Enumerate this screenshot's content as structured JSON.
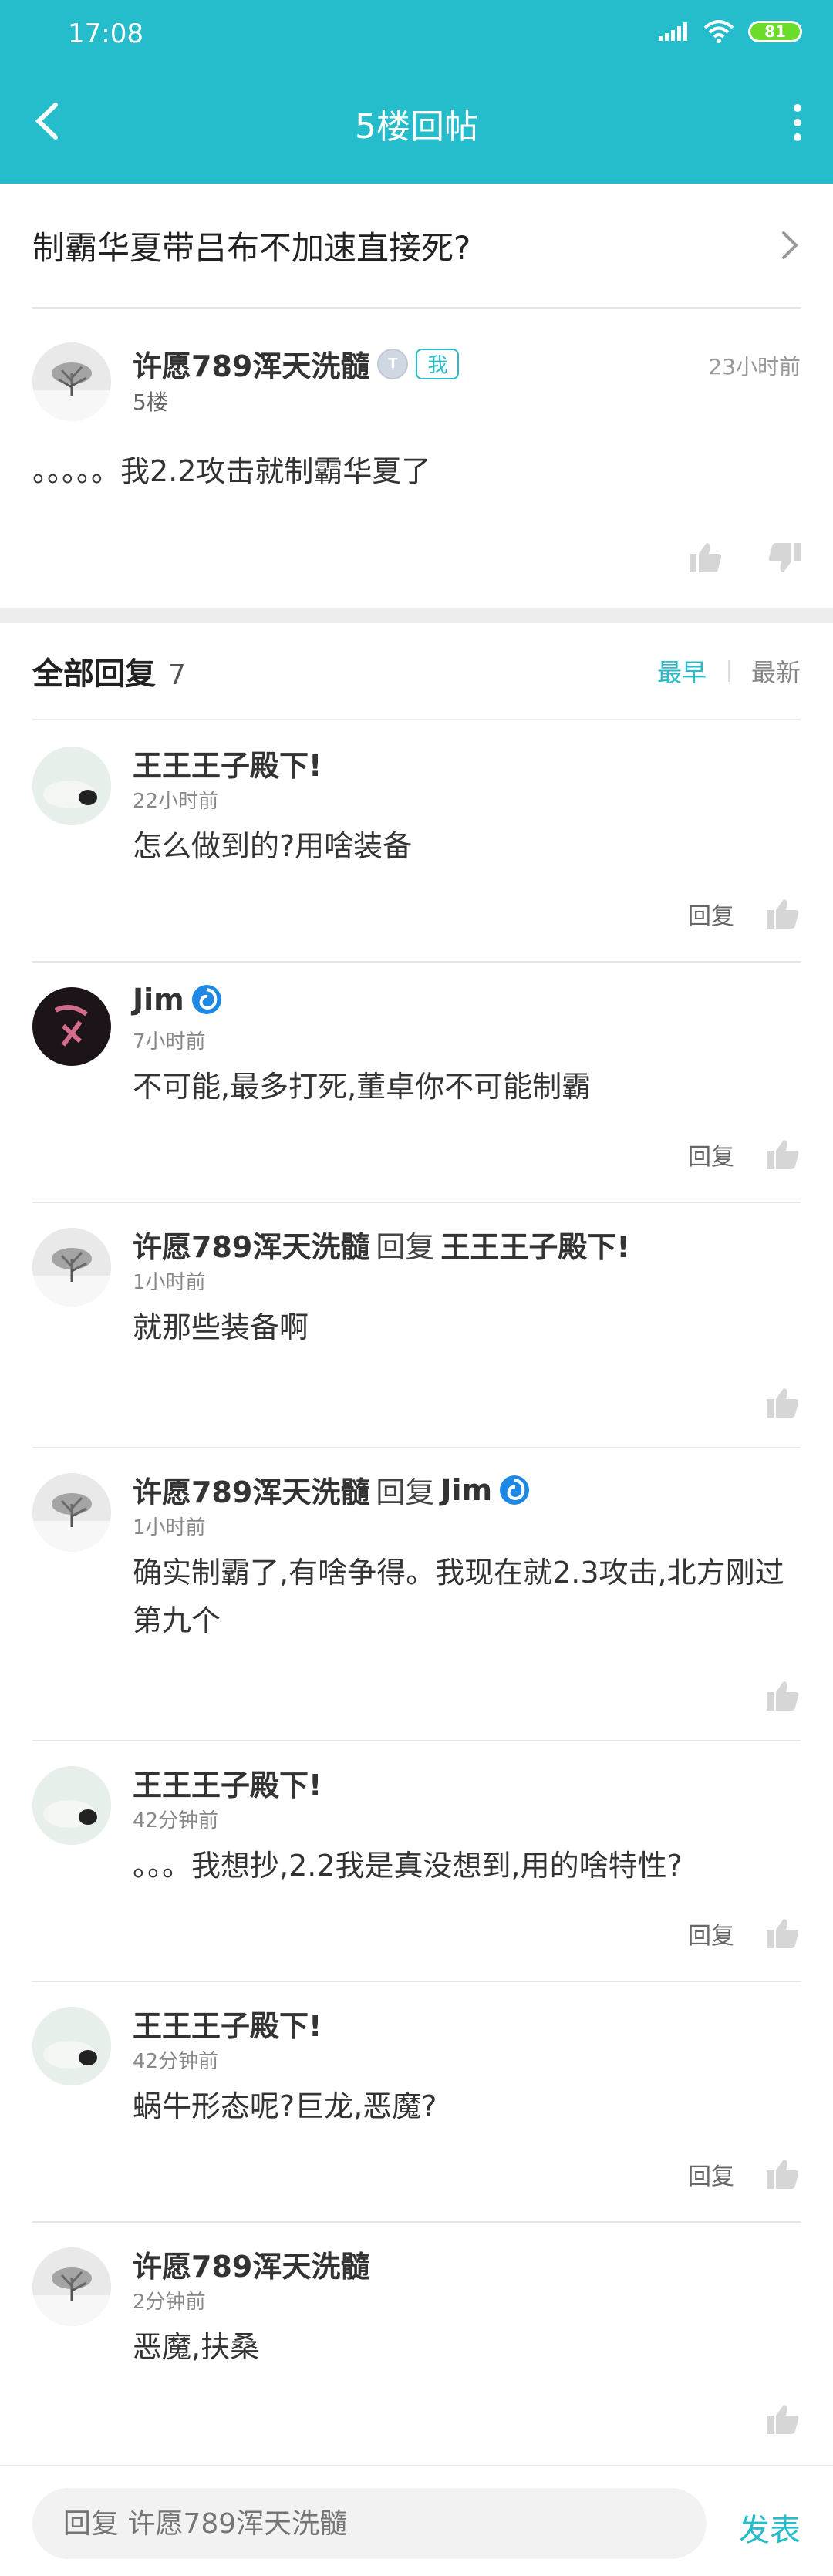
{
  "status": {
    "time": "17:08",
    "battery": "81"
  },
  "header": {
    "title": "5楼回帖"
  },
  "post": {
    "title": "制霸华夏带吕布不加速直接死?",
    "author": "许愿789浑天洗髓",
    "level_badge": "T",
    "me_badge": "我",
    "floor": "5楼",
    "time": "23小时前",
    "body": "。。。。。我2.2攻击就制霸华夏了"
  },
  "replies_header": {
    "title": "全部回复",
    "count": "7",
    "sort_early": "最早",
    "sort_new": "最新"
  },
  "reply_label": "回复",
  "replies": [
    {
      "name": "王王王子殿下!",
      "time": "22小时前",
      "text": "怎么做到的?用啥装备"
    },
    {
      "name": "Jim",
      "time": "7小时前",
      "text": "不可能,最多打死,董卓你不可能制霸"
    },
    {
      "name": "许愿789浑天洗髓",
      "reply_word": "回复",
      "reply_to": "王王王子殿下!",
      "time": "1小时前",
      "text": "就那些装备啊"
    },
    {
      "name": "许愿789浑天洗髓",
      "reply_word": "回复",
      "reply_to": "Jim",
      "time": "1小时前",
      "text": "确实制霸了,有啥争得。我现在就2.3攻击,北方刚过第九个"
    },
    {
      "name": "王王王子殿下!",
      "time": "42分钟前",
      "text": "。。。我想抄,2.2我是真没想到,用的啥特性?"
    },
    {
      "name": "王王王子殿下!",
      "time": "42分钟前",
      "text": "蜗牛形态呢?巨龙,恶魔?"
    },
    {
      "name": "许愿789浑天洗髓",
      "time": "2分钟前",
      "text": "恶魔,扶桑"
    }
  ],
  "bottom": {
    "placeholder": "回复 许愿789浑天洗髓",
    "send": "发表"
  },
  "colors": {
    "accent": "#25bccb",
    "divider": "#e6e6e6"
  }
}
